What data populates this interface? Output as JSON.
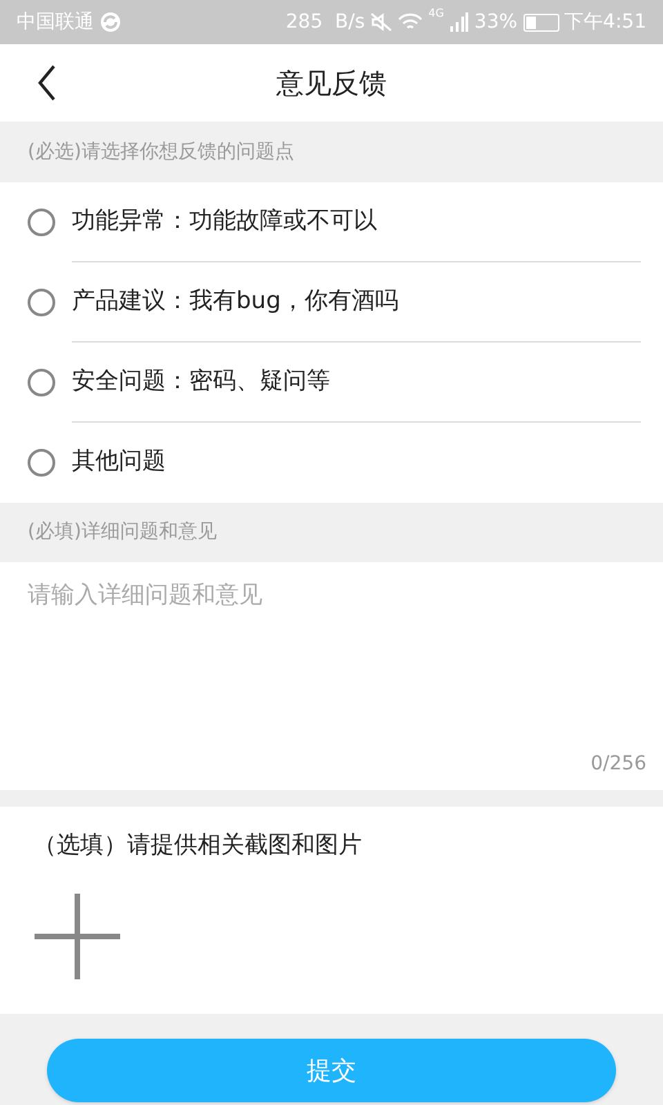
{
  "status_bar": {
    "carrier": "中国联通",
    "speed": "285  B/s",
    "network": "4G",
    "battery": "33%",
    "time": "下午4:51"
  },
  "header": {
    "title": "意见反馈"
  },
  "options_label": "(必选)请选择你想反馈的问题点",
  "options": [
    {
      "label": "功能异常：功能故障或不可以",
      "selected": false
    },
    {
      "label": "产品建议：我有bug，你有酒吗",
      "selected": false
    },
    {
      "label": "安全问题：密码、疑问等",
      "selected": false
    },
    {
      "label": "其他问题",
      "selected": false
    }
  ],
  "detail_label": "(必填)详细问题和意见",
  "detail": {
    "placeholder": "请输入详细问题和意见",
    "counter": "0/256"
  },
  "upload": {
    "label": "（选填）请提供相关截图和图片"
  },
  "submit": "提交"
}
